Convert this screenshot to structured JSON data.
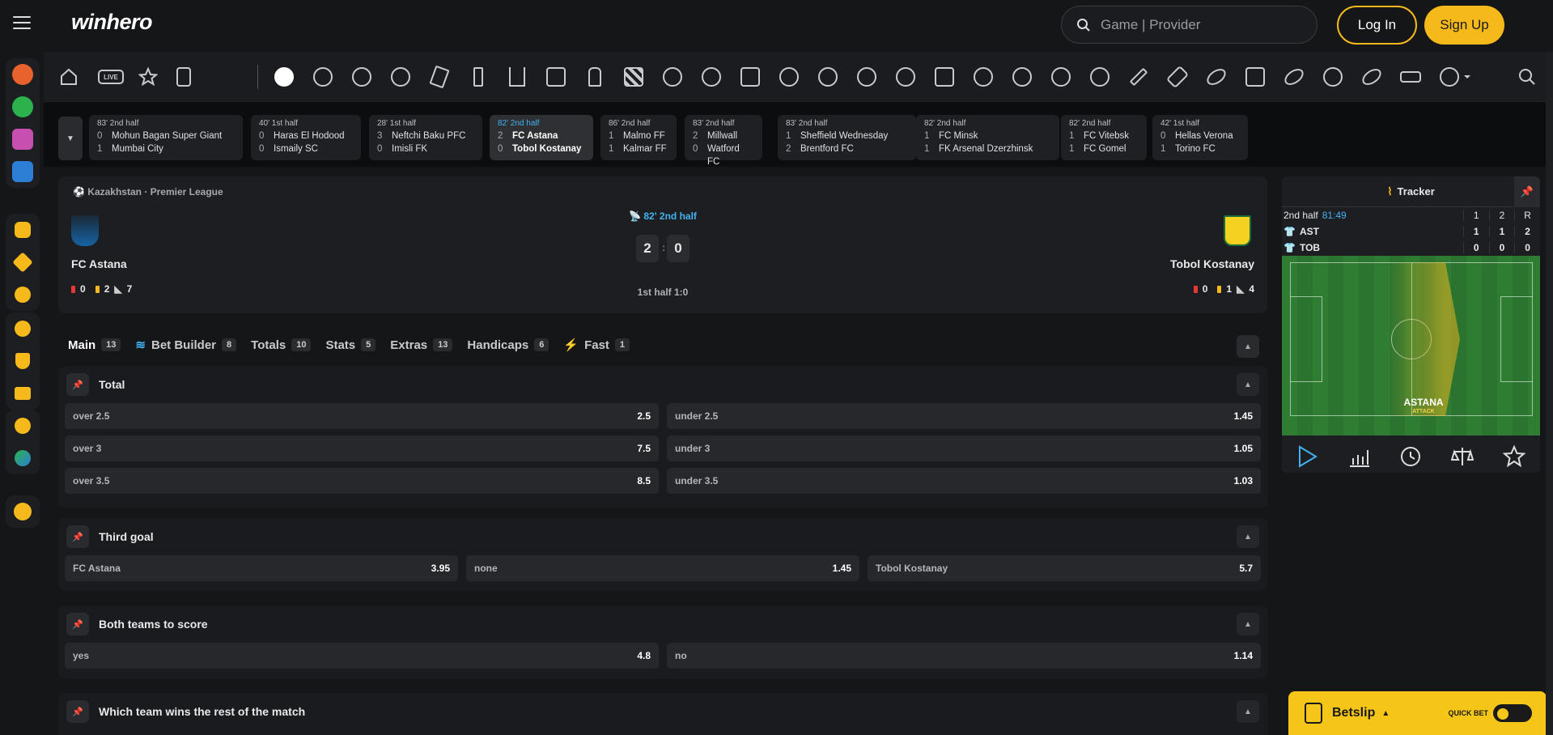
{
  "header": {
    "logo_a": "w",
    "logo_b": "inhero",
    "search_placeholder": "Game | Provider",
    "login": "Log In",
    "signup": "Sign Up"
  },
  "sports_bar": {
    "live_label": "LIVE"
  },
  "live_strip": [
    {
      "status": "83' 2nd half",
      "s1": "0",
      "t1": "Mohun Bagan Super Giant",
      "s2": "1",
      "t2": "Mumbai City"
    },
    {
      "status": "40' 1st half",
      "s1": "0",
      "t1": "Haras El Hodood",
      "s2": "0",
      "t2": "Ismaily SC"
    },
    {
      "status": "28' 1st half",
      "s1": "3",
      "t1": "Neftchi Baku PFC",
      "s2": "0",
      "t2": "Imisli FK"
    },
    {
      "status": "82' 2nd half",
      "s1": "2",
      "t1": "FC Astana",
      "s2": "0",
      "t2": "Tobol Kostanay"
    },
    {
      "status": "86' 2nd half",
      "s1": "1",
      "t1": "Malmo FF",
      "s2": "1",
      "t2": "Kalmar FF"
    },
    {
      "status": "83' 2nd half",
      "s1": "2",
      "t1": "Millwall",
      "s2": "0",
      "t2": "Watford FC"
    },
    {
      "status": "83' 2nd half",
      "s1": "1",
      "t1": "Sheffield Wednesday",
      "s2": "2",
      "t2": "Brentford FC"
    },
    {
      "status": "82' 2nd half",
      "s1": "1",
      "t1": "FC Minsk",
      "s2": "1",
      "t2": "FK Arsenal Dzerzhinsk"
    },
    {
      "status": "82' 2nd half",
      "s1": "1",
      "t1": "FC Vitebsk",
      "s2": "1",
      "t2": "FC Gomel"
    },
    {
      "status": "42' 1st half",
      "s1": "0",
      "t1": "Hellas Verona",
      "s2": "1",
      "t2": "Torino FC"
    }
  ],
  "match": {
    "league": "Kazakhstan · Premier League",
    "status": "82' 2nd half",
    "home": "FC Astana",
    "away": "Tobol Kostanay",
    "score_home": "2",
    "score_sep": ":",
    "score_away": "0",
    "half": "1st half 1:0",
    "home_red": "0",
    "home_yellow": "2",
    "home_corners": "7",
    "away_red": "0",
    "away_yellow": "1",
    "away_corners": "4"
  },
  "tabs": [
    {
      "label": "Main",
      "count": "13"
    },
    {
      "label": "Bet Builder",
      "count": "8"
    },
    {
      "label": "Totals",
      "count": "10"
    },
    {
      "label": "Stats",
      "count": "5"
    },
    {
      "label": "Extras",
      "count": "13"
    },
    {
      "label": "Handicaps",
      "count": "6"
    },
    {
      "label": "Fast",
      "count": "1"
    }
  ],
  "markets": {
    "total": {
      "title": "Total",
      "rows": [
        [
          {
            "l": "over 2.5",
            "v": "2.5"
          },
          {
            "l": "under 2.5",
            "v": "1.45"
          }
        ],
        [
          {
            "l": "over 3",
            "v": "7.5"
          },
          {
            "l": "under 3",
            "v": "1.05"
          }
        ],
        [
          {
            "l": "over 3.5",
            "v": "8.5"
          },
          {
            "l": "under 3.5",
            "v": "1.03"
          }
        ]
      ]
    },
    "third_goal": {
      "title": "Third goal",
      "rows": [
        [
          {
            "l": "FC Astana",
            "v": "3.95"
          },
          {
            "l": "none",
            "v": "1.45"
          },
          {
            "l": "Tobol Kostanay",
            "v": "5.7"
          }
        ]
      ]
    },
    "btts": {
      "title": "Both teams to score",
      "rows": [
        [
          {
            "l": "yes",
            "v": "4.8"
          },
          {
            "l": "no",
            "v": "1.14"
          }
        ]
      ]
    },
    "rest": {
      "title": "Which team wins the rest of the match"
    }
  },
  "tracker": {
    "title": "Tracker",
    "period": "2nd half",
    "clock": "81:49",
    "col1": "1",
    "col2": "2",
    "colR": "R",
    "teams": [
      {
        "name": "AST",
        "c1": "1",
        "c2": "1",
        "r": "2"
      },
      {
        "name": "TOB",
        "c1": "0",
        "c2": "0",
        "r": "0"
      }
    ],
    "attack_team": "ASTANA",
    "attack_label": "ATTACK"
  },
  "betslip": {
    "label": "Betslip",
    "quick_bet": "QUICK BET"
  },
  "colors": {
    "accent": "#f5b91c",
    "live_blue": "#42b3f0",
    "background": "#151618"
  }
}
